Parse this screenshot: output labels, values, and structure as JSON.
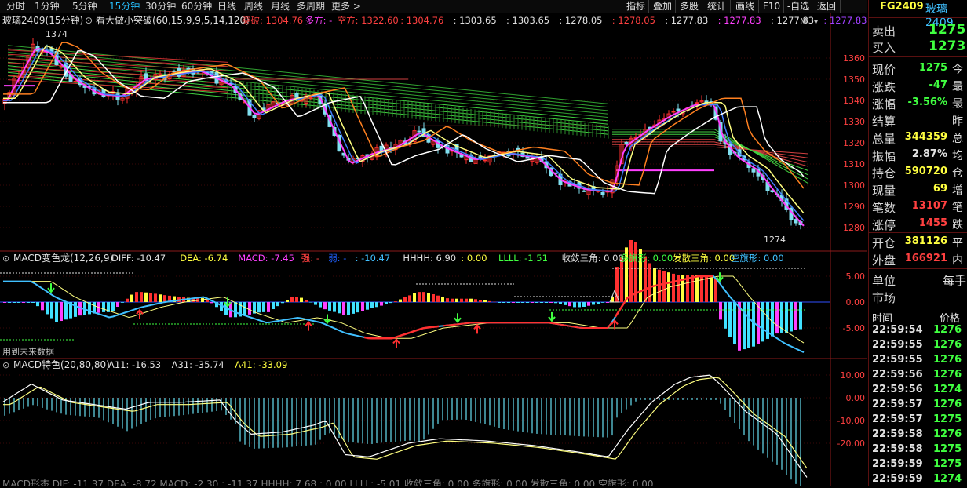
{
  "topbar": {
    "left": [
      "分时",
      "1分钟",
      "5分钟",
      "15分钟",
      "30分钟",
      "60分钟",
      "日线",
      "周线",
      "月线",
      "多周期",
      "更多 >"
    ],
    "active_index": 3,
    "right": [
      "指标",
      "叠加",
      "多股",
      "统计",
      "画线",
      "F10",
      "-自选",
      "返回"
    ]
  },
  "main": {
    "symbol_label": "玻璃2409(15分钟)",
    "indicator_name": "看大做小突破(60,15,9,9,5,14,120)",
    "indicator_values": [
      {
        "text": "突破: 1304.76",
        "color": "#ff4040"
      },
      {
        "text": "多方: -",
        "color": "#ff40ff"
      },
      {
        "text": "空方: 1322.60",
        "color": "#ff4040"
      },
      {
        "text": ": 1304.76",
        "color": "#ff4040"
      },
      {
        "text": ": 1303.65",
        "color": "#e0e0e0"
      },
      {
        "text": ": 1303.65",
        "color": "#e0e0e0"
      },
      {
        "text": ": 1278.05",
        "color": "#e0e0e0"
      },
      {
        "text": ": 1278.05",
        "color": "#ff4040"
      },
      {
        "text": ": 1277.83",
        "color": "#e0e0e0"
      },
      {
        "text": ": 1277.83",
        "color": "#ff40ff"
      },
      {
        "text": ": 1277.83",
        "color": "#e0e0e0"
      },
      {
        "text": ": 1277.83",
        "color": "#a040ff"
      }
    ],
    "price_axis": [
      "1360",
      "1350",
      "1340",
      "1330",
      "1320",
      "1310",
      "1300",
      "1290",
      "1280"
    ],
    "high_label": "1374",
    "low_label": "1274",
    "corner_mark": "M"
  },
  "macd1": {
    "title": "MACD变色龙(12,26,9)",
    "values": [
      {
        "text": "DIFF: -10.47",
        "color": "#e0e0e0"
      },
      {
        "text": "DEA: -6.74",
        "color": "#ffff40"
      },
      {
        "text": "MACD: -7.45",
        "color": "#ff40ff"
      },
      {
        "text": "强: -",
        "color": "#ff4040"
      },
      {
        "text": "弱: -",
        "color": "#2060ff"
      },
      {
        "text": ": -10.47",
        "color": "#40c0ff"
      },
      {
        "text": "HHHH: 6.90",
        "color": "#e0e0e0"
      },
      {
        "text": ": 0.00",
        "color": "#ffff40"
      },
      {
        "text": "LLLL: -1.51",
        "color": "#40ff40"
      },
      {
        "text": "收敛三角: 0.00",
        "color": "#e0e0e0"
      },
      {
        "text": "多旗形: 0.00",
        "color": "#40ff40"
      },
      {
        "text": "发散三角: 0.00",
        "color": "#ffff40"
      },
      {
        "text": "空旗形: 0.00",
        "color": "#40c0ff"
      }
    ],
    "axis": [
      "5.00",
      "0.00",
      "-5.00"
    ],
    "future_note": "用到未来数据"
  },
  "macd2": {
    "title": "MACD特色(20,80,80)",
    "values": [
      {
        "text": "A11: -16.53",
        "color": "#e0e0e0"
      },
      {
        "text": "A31: -35.74",
        "color": "#e0e0e0"
      },
      {
        "text": "A41: -33.09",
        "color": "#ffff40"
      }
    ],
    "axis": [
      "10.00",
      "0.00",
      "-10.00",
      "-20.00"
    ]
  },
  "bottom_cut_text": "MACD形态  DIF: -11.37  DEA: -8.72  MACD: -2.30  : -11.37  HHHH: 7.68  : 0.00  LLLL: -5.01  收敛三角: 0.00  多旗形: 0.00  发散三角: 0.00  空旗形: 0.00",
  "side": {
    "code": "FG2409",
    "name": "玻璃2409",
    "sell_label": "卖出",
    "sell_value": "1275",
    "buy_label": "买入",
    "buy_value": "1273",
    "rows1": [
      {
        "label": "现价",
        "value": "1275",
        "color": "#40ff40",
        "extra": "今"
      },
      {
        "label": "涨跌",
        "value": "-47",
        "color": "#40ff40",
        "extra": "最"
      },
      {
        "label": "涨幅",
        "value": "-3.56%",
        "color": "#40ff40",
        "extra": "最"
      },
      {
        "label": "结算",
        "value": "",
        "color": "#e0e0e0",
        "extra": "昨"
      },
      {
        "label": "总量",
        "value": "344359",
        "color": "#ffff40",
        "extra": "总"
      },
      {
        "label": "振幅",
        "value": "2.87%",
        "color": "#e0e0e0",
        "extra": "均"
      }
    ],
    "rows2": [
      {
        "label": "持仓",
        "value": "590720",
        "color": "#ffff40",
        "extra": "仓"
      },
      {
        "label": "现量",
        "value": "69",
        "color": "#ffff40",
        "extra": "增"
      },
      {
        "label": "笔数",
        "value": "13107",
        "color": "#ff4040",
        "extra": "笔"
      },
      {
        "label": "涨停",
        "value": "1455",
        "color": "#ff4040",
        "extra": "跌"
      }
    ],
    "rows3": [
      {
        "label": "开仓",
        "value": "381126",
        "color": "#ffff40",
        "extra": "平"
      },
      {
        "label": "外盘",
        "value": "166921",
        "color": "#ff4040",
        "extra": "内"
      }
    ],
    "unit_label": "单位",
    "unit_value": "每手",
    "market_label": "市场",
    "ticks_header_time": "时间",
    "ticks_header_price": "价格",
    "ticks": [
      {
        "time": "22:59:54",
        "price": "1276"
      },
      {
        "time": "22:59:55",
        "price": "1276"
      },
      {
        "time": "22:59:55",
        "price": "1276"
      },
      {
        "time": "22:59:56",
        "price": "1276"
      },
      {
        "time": "22:59:56",
        "price": "1274"
      },
      {
        "time": "22:59:57",
        "price": "1276"
      },
      {
        "time": "22:59:57",
        "price": "1275"
      },
      {
        "time": "22:59:58",
        "price": "1276"
      },
      {
        "time": "22:59:58",
        "price": "1275"
      },
      {
        "time": "22:59:59",
        "price": "1275"
      },
      {
        "time": "22:59:59",
        "price": "1274"
      }
    ]
  },
  "colors": {
    "up": "#ff3030",
    "down": "#40e0ff",
    "green": "#40ff40",
    "yellow": "#ffff40",
    "magenta": "#ff40ff",
    "grid": "#5a1010"
  }
}
